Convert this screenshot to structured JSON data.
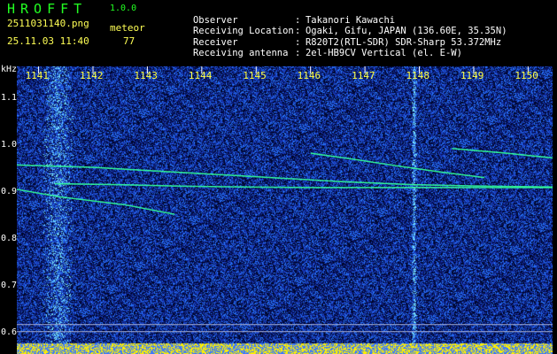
{
  "app": {
    "title": "HROFFT",
    "version": "1.0.0",
    "filename": "2511031140.png",
    "datetime": "25.11.03 11:40",
    "meteor_label": "meteor",
    "meteor_count": "77"
  },
  "station_info": [
    {
      "key": "Observer",
      "sep": ":",
      "value": "Takanori Kawachi"
    },
    {
      "key": "Receiving Location",
      "sep": ":",
      "value": "Ogaki, Gifu, JAPAN (136.60E, 35.35N)"
    },
    {
      "key": "Receiver",
      "sep": ":",
      "value": "R820T2(RTL-SDR) SDR-Sharp 53.372MHz"
    },
    {
      "key": "Receiving antenna",
      "sep": ":",
      "value": "2el-HB9CV Vertical (el. E-W)"
    }
  ],
  "colors": {
    "background": "#000000",
    "accent_green": "#22ff22",
    "label_yellow": "#ffff55",
    "tick_yellow": "#ffff44",
    "noise_blue": "#1a3aa8",
    "meteor_trace": "#33ff99"
  },
  "chart_data": {
    "type": "heatmap",
    "ylabel": "kHz",
    "x_ticks": [
      "1141",
      "1142",
      "1143",
      "1144",
      "1145",
      "1146",
      "1147",
      "1148",
      "1149",
      "1150"
    ],
    "y_ticks": [
      "1.1",
      "1.0",
      "0.9",
      "0.8",
      "0.7",
      "0.6"
    ],
    "x_range": [
      1140.6,
      1150.45
    ],
    "y_range": [
      0.58,
      1.17
    ],
    "grid": true,
    "meteor_traces": [
      {
        "x": [
          1140.6,
          1141.4,
          1142.6,
          1143.5
        ],
        "y": [
          0.908,
          0.892,
          0.875,
          0.855
        ]
      },
      {
        "x": [
          1140.6,
          1142.0,
          1143.5,
          1145.0,
          1146.5,
          1147.9,
          1149.2,
          1150.45
        ],
        "y": [
          0.96,
          0.955,
          0.945,
          0.935,
          0.925,
          0.918,
          0.915,
          0.913
        ]
      },
      {
        "x": [
          1141.3,
          1142.5,
          1143.6,
          1144.8,
          1146.1,
          1147.4,
          1148.6,
          1150.45
        ],
        "y": [
          0.92,
          0.918,
          0.915,
          0.913,
          0.912,
          0.912,
          0.912,
          0.912
        ]
      },
      {
        "x": [
          1146.0,
          1146.8,
          1147.6,
          1148.4,
          1149.2
        ],
        "y": [
          0.985,
          0.972,
          0.958,
          0.945,
          0.933
        ]
      },
      {
        "x": [
          1148.6,
          1149.6,
          1150.45
        ],
        "y": [
          0.995,
          0.985,
          0.975
        ]
      }
    ],
    "vertical_bands": [
      1141.35,
      1147.9
    ]
  }
}
